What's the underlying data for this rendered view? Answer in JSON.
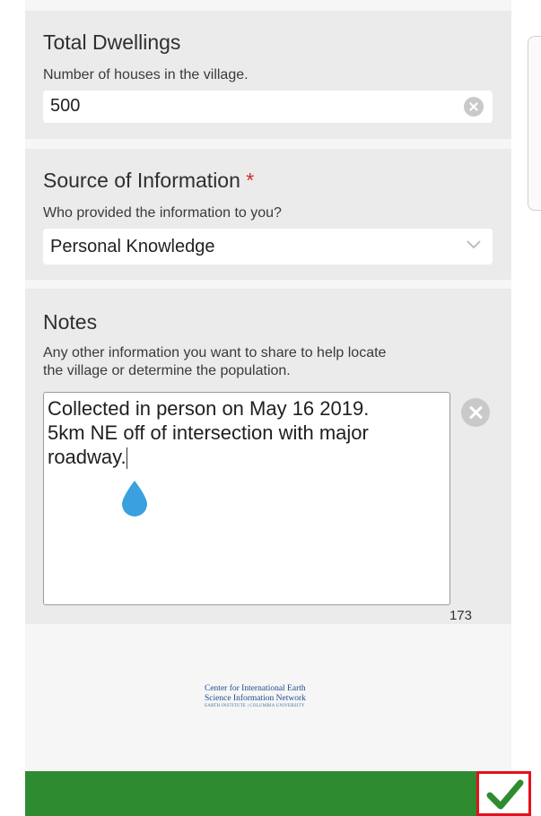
{
  "fields": {
    "dwellings": {
      "label": "Total Dwellings",
      "hint": "Number of houses in the village.",
      "value": "500"
    },
    "source": {
      "label": "Source of Information",
      "required_marker": "*",
      "hint": "Who provided the information to you?",
      "value": "Personal Knowledge"
    },
    "notes": {
      "label": "Notes",
      "hint_line1": "Any other information you want to share to help locate",
      "hint_line2": "the village or determine the population.",
      "value": "Collected in person on May 16 2019.\n5km NE off of intersection with major\nroadway.",
      "char_count": "173"
    }
  },
  "footer": {
    "logo_line1": "Center for International Earth",
    "logo_line2": "Science Information Network",
    "logo_line3": "EARTH INSTITUTE | COLUMBIA UNIVERSITY"
  },
  "icons": {
    "clear": "clear-icon",
    "chevron": "chevron-down-icon",
    "check": "check-icon",
    "caret_handle": "text-cursor-handle-icon"
  },
  "colors": {
    "action_bar": "#2f8b2f",
    "highlight_border": "#e5101b",
    "required": "#d22b2b",
    "handle": "#3aa0e0"
  }
}
